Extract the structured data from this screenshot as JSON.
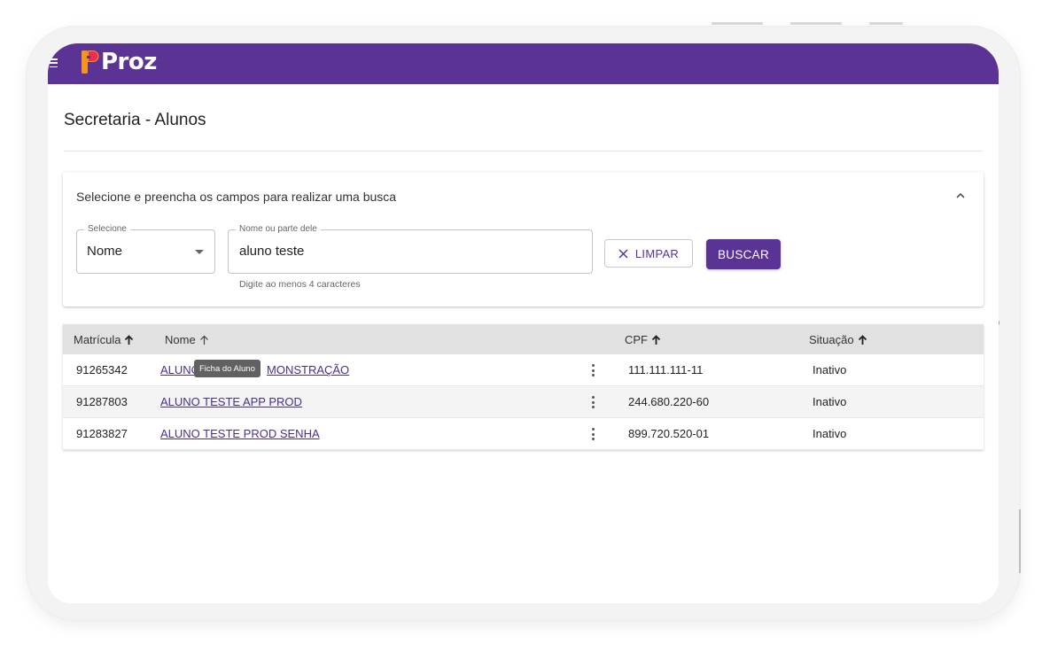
{
  "app": {
    "brand": "Proz"
  },
  "page": {
    "title": "Secretaria - Alunos"
  },
  "search": {
    "heading": "Selecione e preencha os campos para realizar uma busca",
    "select_label": "Selecione",
    "select_value": "Nome",
    "name_label": "Nome ou parte dele",
    "name_value": "aluno teste",
    "helper": "Digite ao menos 4 caracteres",
    "clear_label": "LIMPAR",
    "search_label": "BUSCAR"
  },
  "table": {
    "headers": {
      "matricula": "Matrícula",
      "nome": "Nome",
      "cpf": "CPF",
      "situacao": "Situação"
    },
    "rows": [
      {
        "matricula": "91265342",
        "nome_start": "ALUNO",
        "nome_end": "MONSTRAÇÃO",
        "cpf": "111.111.111-11",
        "situacao": "Inativo"
      },
      {
        "matricula": "91287803",
        "nome": "ALUNO TESTE APP PROD",
        "cpf": "244.680.220-60",
        "situacao": "Inativo"
      },
      {
        "matricula": "91283827",
        "nome": "ALUNO TESTE PROD SENHA",
        "cpf": "899.720.520-01",
        "situacao": "Inativo"
      }
    ]
  },
  "tooltip": {
    "text": "Ficha do Aluno"
  },
  "colors": {
    "brand": "#5a3394",
    "brand_orange": "#f7941d",
    "link": "#4a2f8c"
  },
  "icons": [
    "menu-icon",
    "proz-logo-icon",
    "chevron-up-icon",
    "dropdown-caret-icon",
    "close-icon",
    "arrow-up-icon",
    "more-vert-icon"
  ]
}
